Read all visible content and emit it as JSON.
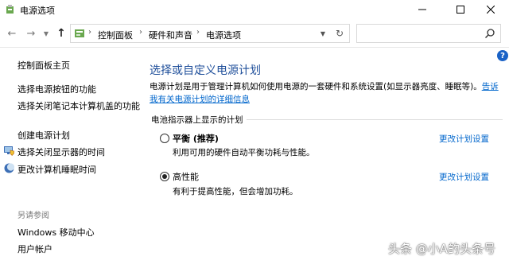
{
  "window": {
    "title": "电源选项",
    "icons": {
      "app": "power-options-icon",
      "minimize": "minimize-icon",
      "maximize": "maximize-icon",
      "close": "close-icon"
    }
  },
  "address_bar": {
    "breadcrumbs": [
      "控制面板",
      "硬件和声音",
      "电源选项"
    ],
    "search_placeholder": ""
  },
  "help": {
    "label": "?"
  },
  "sidebar": {
    "home_link": "控制面板主页",
    "links": [
      {
        "label": "选择电源按钮的功能",
        "icon": ""
      },
      {
        "label": "选择关闭笔记本计算机盖的功能",
        "icon": ""
      },
      {
        "label": "创建电源计划",
        "icon": ""
      },
      {
        "label": "选择关闭显示器的时间",
        "icon": "monitor-shield-icon"
      },
      {
        "label": "更改计算机睡眠时间",
        "icon": "moon-icon"
      }
    ],
    "see_also": {
      "heading": "另请参阅",
      "links": [
        "Windows 移动中心",
        "用户帐户"
      ]
    }
  },
  "main": {
    "title": "选择或自定义电源计划",
    "description": "电源计划是用于管理计算机如何使用电源的一套硬件和系统设置(如显示器亮度、睡眠等)。",
    "description_link": "告诉我有关电源计划的详细信息",
    "group_label": "电池指示器上显示的计划",
    "plans": [
      {
        "name": "平衡 (推荐)",
        "description": "利用可用的硬件自动平衡功耗与性能。",
        "link": "更改计划设置",
        "selected": false
      },
      {
        "name": "高性能",
        "description": "有利于提高性能，但会增加功耗。",
        "link": "更改计划设置",
        "selected": true
      }
    ]
  },
  "watermark": "头条 @小A的头条号"
}
